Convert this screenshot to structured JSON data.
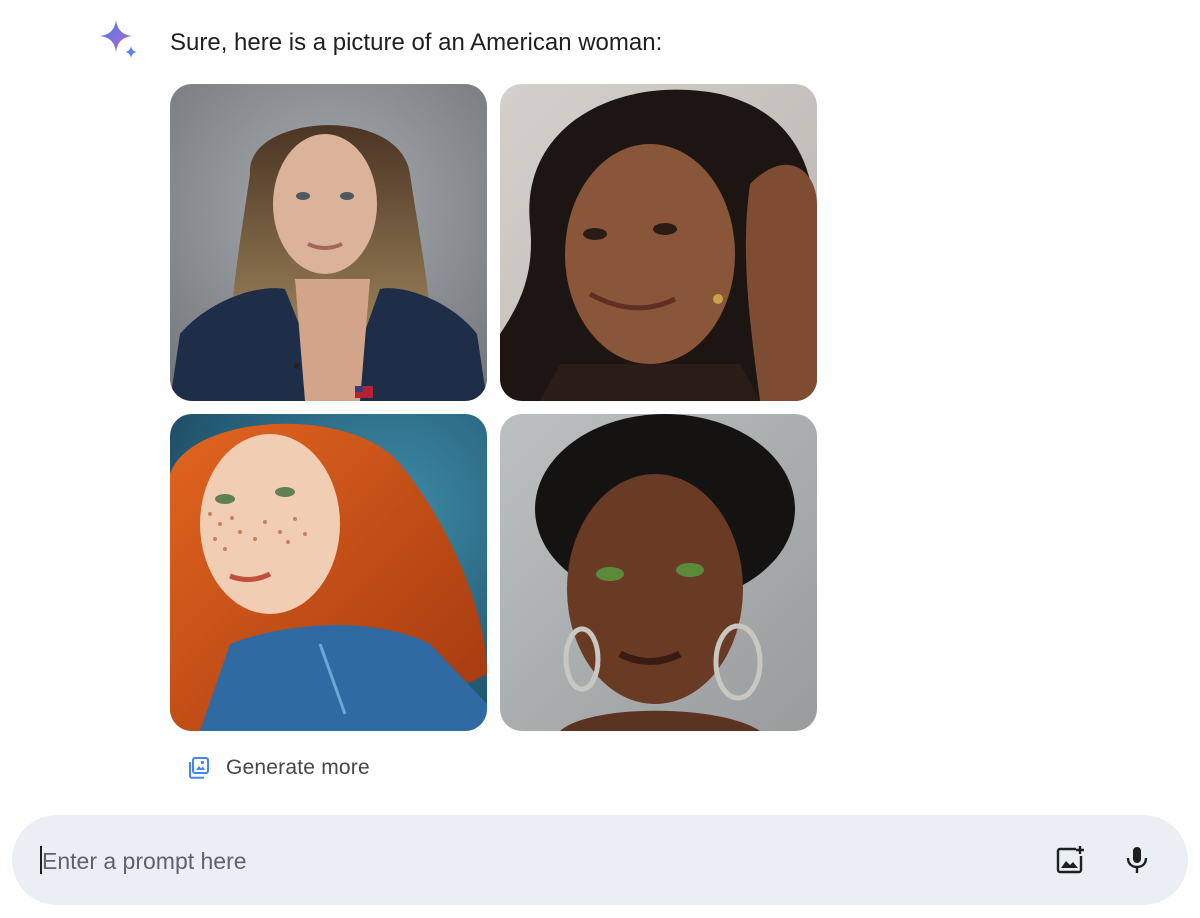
{
  "response": {
    "text": "Sure, here is a picture of an American woman:"
  },
  "images": [
    {
      "icon": "generated-image-1"
    },
    {
      "icon": "generated-image-2"
    },
    {
      "icon": "generated-image-3"
    },
    {
      "icon": "generated-image-4"
    }
  ],
  "actions": {
    "generate_more_label": "Generate more"
  },
  "prompt": {
    "placeholder": "Enter a prompt here",
    "value": ""
  },
  "icons": {
    "assistant": "sparkle-icon",
    "generate_more": "image-stack-icon",
    "upload_image": "add-image-icon",
    "microphone": "microphone-icon"
  },
  "colors": {
    "prompt_bar_bg": "#eaeff6",
    "accent_blue": "#4285f4",
    "icon_dark": "#1f1f1f"
  }
}
